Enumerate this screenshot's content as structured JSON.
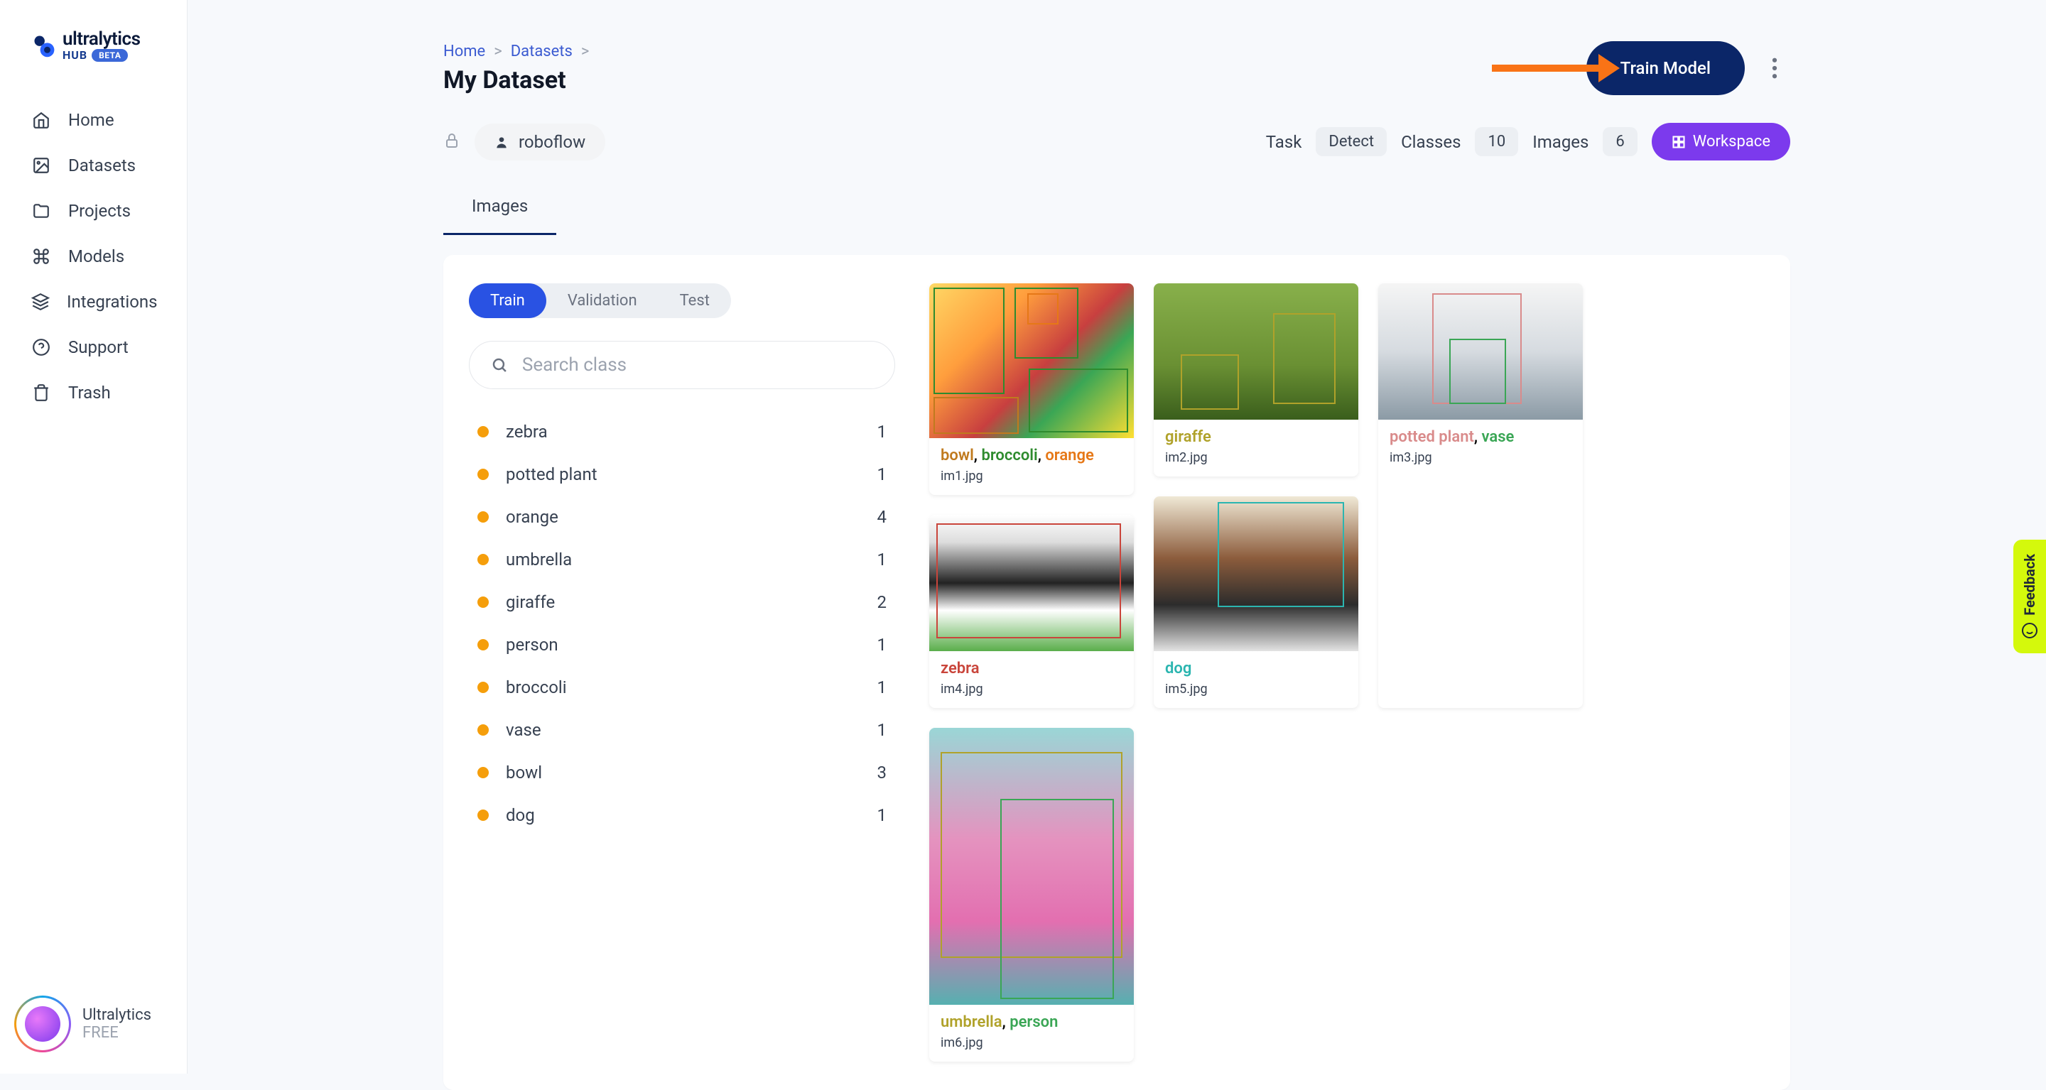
{
  "brand": {
    "name": "ultralytics",
    "sub": "HUB",
    "badge": "BETA"
  },
  "sidebar": {
    "items": [
      {
        "label": "Home"
      },
      {
        "label": "Datasets"
      },
      {
        "label": "Projects"
      },
      {
        "label": "Models"
      },
      {
        "label": "Integrations"
      },
      {
        "label": "Support"
      },
      {
        "label": "Trash"
      }
    ],
    "footer": {
      "name": "Ultralytics",
      "plan": "FREE"
    }
  },
  "breadcrumb": {
    "home": "Home",
    "datasets": "Datasets"
  },
  "page": {
    "title": "My Dataset",
    "train_btn": "Train Model",
    "workspace_btn": "Workspace"
  },
  "owner": {
    "name": "roboflow"
  },
  "stats": {
    "task_label": "Task",
    "task_value": "Detect",
    "classes_label": "Classes",
    "classes_value": "10",
    "images_label": "Images",
    "images_value": "6"
  },
  "tabs": {
    "images": "Images"
  },
  "splits": {
    "train": "Train",
    "validation": "Validation",
    "test": "Test"
  },
  "search": {
    "placeholder": "Search class"
  },
  "classes": [
    {
      "name": "zebra",
      "count": "1"
    },
    {
      "name": "potted plant",
      "count": "1"
    },
    {
      "name": "orange",
      "count": "4"
    },
    {
      "name": "umbrella",
      "count": "1"
    },
    {
      "name": "giraffe",
      "count": "2"
    },
    {
      "name": "person",
      "count": "1"
    },
    {
      "name": "broccoli",
      "count": "1"
    },
    {
      "name": "vase",
      "count": "1"
    },
    {
      "name": "bowl",
      "count": "3"
    },
    {
      "name": "dog",
      "count": "1"
    }
  ],
  "images": {
    "im1": {
      "filename": "im1.jpg",
      "l1": "bowl",
      "l2": "broccoli",
      "l3": "orange"
    },
    "im2": {
      "filename": "im2.jpg",
      "l1": "giraffe"
    },
    "im3": {
      "filename": "im3.jpg",
      "l1": "potted plant",
      "l2": "vase"
    },
    "im4": {
      "filename": "im4.jpg",
      "l1": "zebra"
    },
    "im5": {
      "filename": "im5.jpg",
      "l1": "dog"
    },
    "im6": {
      "filename": "im6.jpg",
      "l1": "umbrella",
      "l2": "person"
    }
  },
  "feedback": {
    "label": "Feedback"
  },
  "colors": {
    "bowl": "#c07a1e",
    "broccoli": "#2e8b2e",
    "orange": "#e67817",
    "giraffe": "#b0a22a",
    "potted_plant": "#d98b8b",
    "vase": "#3aa655",
    "zebra": "#c9453b",
    "dog": "#2bb5b0",
    "umbrella": "#b0a22a",
    "person": "#3aa655"
  }
}
